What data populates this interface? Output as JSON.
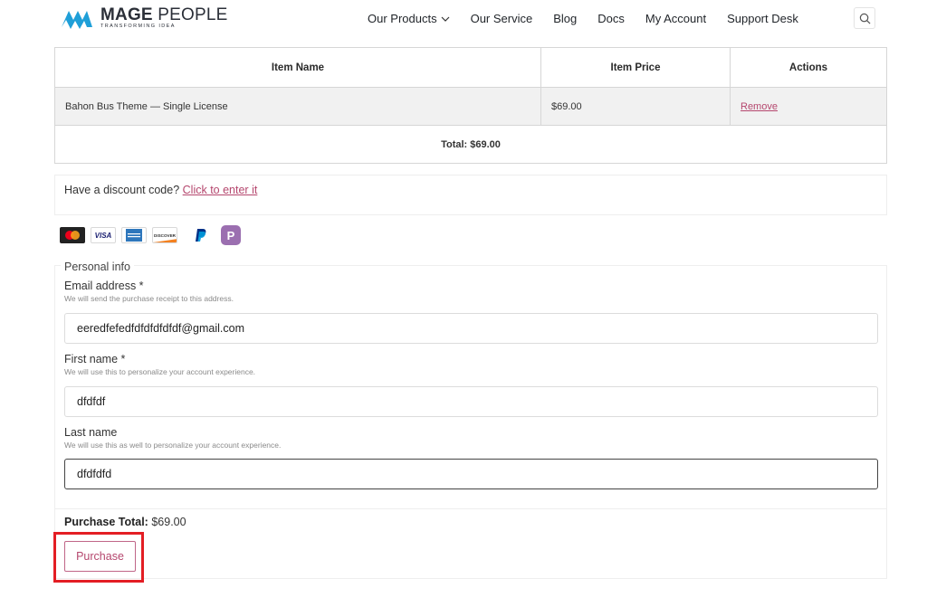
{
  "header": {
    "logo_name_bold": "MAGE",
    "logo_name_regular": "PEOPLE",
    "logo_tagline": "TRANSFORMING IDEA",
    "nav": [
      {
        "label": "Our Products",
        "has_dropdown": true
      },
      {
        "label": "Our Service"
      },
      {
        "label": "Blog"
      },
      {
        "label": "Docs"
      },
      {
        "label": "My Account"
      },
      {
        "label": "Support Desk"
      }
    ],
    "search_icon": "search-icon",
    "brand_color": "#1f9fd8"
  },
  "cart": {
    "headers": {
      "name": "Item Name",
      "price": "Item Price",
      "actions": "Actions"
    },
    "items": [
      {
        "name": "Bahon Bus Theme — Single License",
        "price": "$69.00",
        "action": "Remove"
      }
    ],
    "total": "Total: $69.00"
  },
  "discount": {
    "text": "Have a discount code?",
    "link": "Click to enter it"
  },
  "payment_icons": [
    "mastercard-icon",
    "visa-icon",
    "amex-icon",
    "discover-icon",
    "paypal-icon",
    "p-payment-icon"
  ],
  "payment_icon_text": {
    "visa": "VISA",
    "discover": "DISCOVER",
    "paypal": "PayPal",
    "p": "P"
  },
  "personal_info": {
    "legend": "Personal info",
    "email": {
      "label": "Email address *",
      "desc": "We will send the purchase receipt to this address.",
      "value": "eeredfefedfdfdfdfdfdf@gmail.com"
    },
    "first_name": {
      "label": "First name *",
      "desc": "We will use this to personalize your account experience.",
      "value": "dfdfdf"
    },
    "last_name": {
      "label": "Last name",
      "desc": "We will use this as well to personalize your account experience.",
      "value": "dfdfdfd"
    }
  },
  "purchase": {
    "total_label": "Purchase Total:",
    "total_value": "$69.00",
    "button": "Purchase",
    "accent_color": "#b5476e",
    "highlight_color": "#e31e24"
  }
}
